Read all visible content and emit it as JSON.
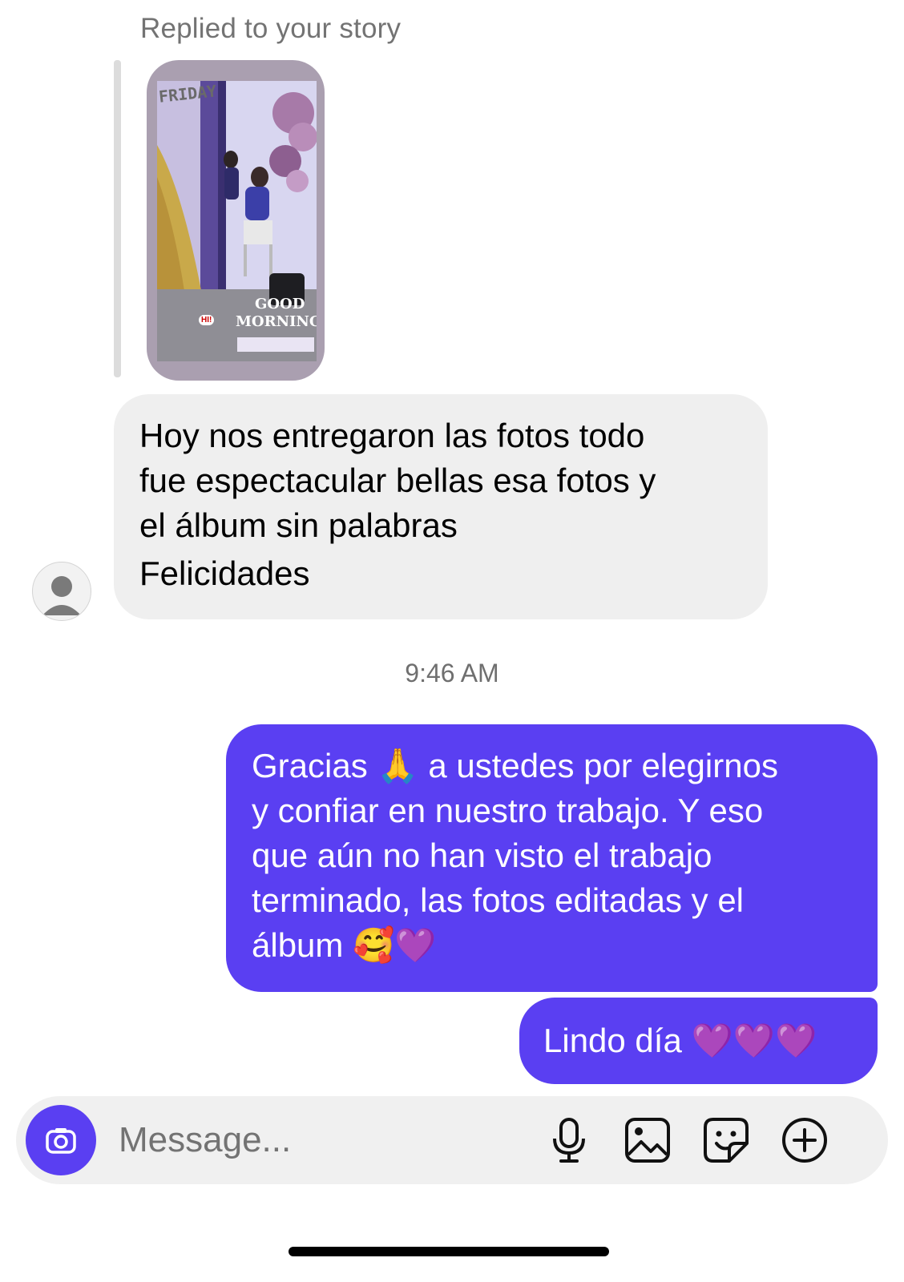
{
  "reply": {
    "caption": "Replied to your story",
    "story": {
      "top_text": "FRIDAY",
      "sticker_line1": "GOOD",
      "sticker_line2": "MORNING",
      "badge": "HI!"
    }
  },
  "messages": [
    {
      "direction": "incoming",
      "text": "Hoy nos entregaron las fotos todo\nfue espectacular  bellas esa fotos y\nel álbum sin palabras",
      "text2": "Felicidades"
    },
    {
      "direction": "outgoing",
      "text": "Gracias 🙏 a ustedes por elegirnos\ny confiar en nuestro trabajo. Y eso\nque aún no han visto el trabajo\nterminado, las fotos editadas y el\nálbum 🥰💜"
    },
    {
      "direction": "outgoing",
      "text": "Lindo día 💜💜💜"
    }
  ],
  "timestamp": "9:46 AM",
  "composer": {
    "placeholder": "Message...",
    "icons": [
      "camera-icon",
      "microphone-icon",
      "gallery-icon",
      "sticker-icon",
      "add-icon"
    ]
  },
  "colors": {
    "outgoing_bubble": "#5a3ff2",
    "incoming_bubble": "#efefef",
    "accent": "#5a3ff2"
  }
}
